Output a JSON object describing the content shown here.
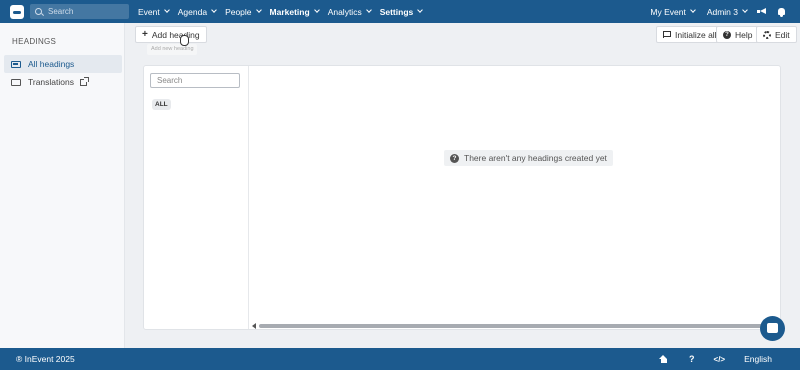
{
  "topbar": {
    "search_placeholder": "Search",
    "nav": [
      "Event",
      "Agenda",
      "People",
      "Marketing",
      "Analytics",
      "Settings"
    ],
    "my_event": "My Event",
    "admin": "Admin 3"
  },
  "sidebar": {
    "title": "HEADINGS",
    "items": [
      {
        "label": "All headings",
        "icon": "list-icon"
      },
      {
        "label": "Translations",
        "icon": "translate-icon"
      }
    ]
  },
  "toolbar": {
    "add_heading": "Add heading",
    "tooltip": "Add new heading",
    "initialize_all": "Initialize all",
    "help": "Help",
    "edit": "Edit"
  },
  "panel": {
    "search_placeholder": "Search",
    "filter_all": "ALL",
    "empty_message": "There aren't any headings created yet"
  },
  "footer": {
    "copyright": "® InEvent 2025",
    "language": "English"
  },
  "colors": {
    "brand": "#1c5a8e"
  }
}
